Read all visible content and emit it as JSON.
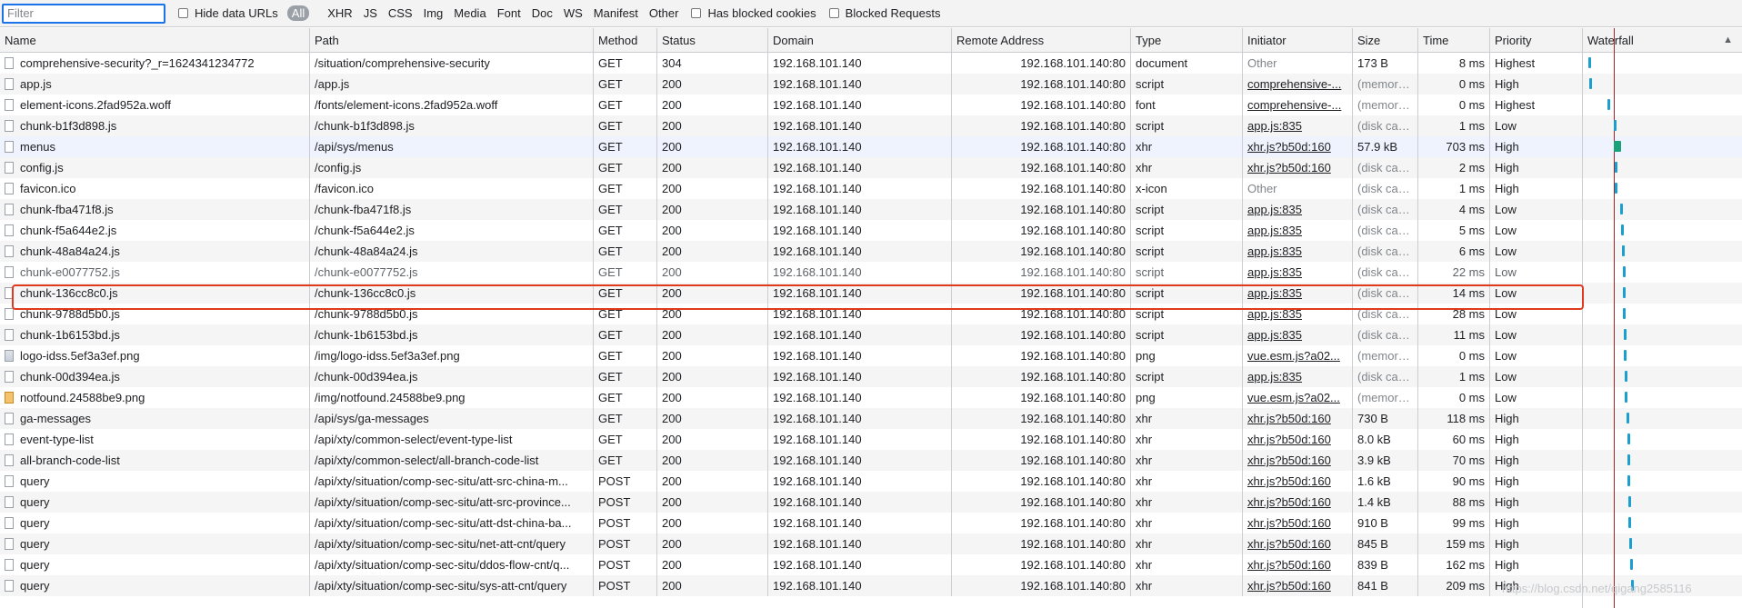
{
  "toolbar": {
    "filter_placeholder": "Filter",
    "hide_data_urls": "Hide data URLs",
    "types": [
      "All",
      "XHR",
      "JS",
      "CSS",
      "Img",
      "Media",
      "Font",
      "Doc",
      "WS",
      "Manifest",
      "Other"
    ],
    "has_blocked_cookies": "Has blocked cookies",
    "blocked_requests": "Blocked Requests"
  },
  "columns": [
    "Name",
    "Path",
    "Method",
    "Status",
    "Domain",
    "Remote Address",
    "Type",
    "Initiator",
    "Size",
    "Time",
    "Priority",
    "Waterfall"
  ],
  "sort_arrow": "▲",
  "rows": [
    {
      "name": "comprehensive-security?_r=1624341234772",
      "path": "/situation/comprehensive-security",
      "method": "GET",
      "status": "304",
      "domain": "192.168.101.140",
      "remote": "192.168.101.140:80",
      "type": "document",
      "initiator": "Other",
      "size": "173 B",
      "time": "8 ms",
      "priority": "Highest"
    },
    {
      "name": "app.js",
      "path": "/app.js",
      "method": "GET",
      "status": "200",
      "domain": "192.168.101.140",
      "remote": "192.168.101.140:80",
      "type": "script",
      "initiator": "comprehensive-...",
      "size": "(memory...",
      "time": "0 ms",
      "priority": "High"
    },
    {
      "name": "element-icons.2fad952a.woff",
      "path": "/fonts/element-icons.2fad952a.woff",
      "method": "GET",
      "status": "200",
      "domain": "192.168.101.140",
      "remote": "192.168.101.140:80",
      "type": "font",
      "initiator": "comprehensive-...",
      "size": "(memory...",
      "time": "0 ms",
      "priority": "Highest"
    },
    {
      "name": "chunk-b1f3d898.js",
      "path": "/chunk-b1f3d898.js",
      "method": "GET",
      "status": "200",
      "domain": "192.168.101.140",
      "remote": "192.168.101.140:80",
      "type": "script",
      "initiator": "app.js:835",
      "size": "(disk cac...",
      "time": "1 ms",
      "priority": "Low"
    },
    {
      "name": "menus",
      "path": "/api/sys/menus",
      "method": "GET",
      "status": "200",
      "domain": "192.168.101.140",
      "remote": "192.168.101.140:80",
      "type": "xhr",
      "initiator": "xhr.js?b50d:160",
      "size": "57.9 kB",
      "time": "703 ms",
      "priority": "High"
    },
    {
      "name": "config.js",
      "path": "/config.js",
      "method": "GET",
      "status": "200",
      "domain": "192.168.101.140",
      "remote": "192.168.101.140:80",
      "type": "xhr",
      "initiator": "xhr.js?b50d:160",
      "size": "(disk cac...",
      "time": "2 ms",
      "priority": "High"
    },
    {
      "name": "favicon.ico",
      "path": "/favicon.ico",
      "method": "GET",
      "status": "200",
      "domain": "192.168.101.140",
      "remote": "192.168.101.140:80",
      "type": "x-icon",
      "initiator": "Other",
      "size": "(disk cac...",
      "time": "1 ms",
      "priority": "High"
    },
    {
      "name": "chunk-fba471f8.js",
      "path": "/chunk-fba471f8.js",
      "method": "GET",
      "status": "200",
      "domain": "192.168.101.140",
      "remote": "192.168.101.140:80",
      "type": "script",
      "initiator": "app.js:835",
      "size": "(disk cac...",
      "time": "4 ms",
      "priority": "Low"
    },
    {
      "name": "chunk-f5a644e2.js",
      "path": "/chunk-f5a644e2.js",
      "method": "GET",
      "status": "200",
      "domain": "192.168.101.140",
      "remote": "192.168.101.140:80",
      "type": "script",
      "initiator": "app.js:835",
      "size": "(disk cac...",
      "time": "5 ms",
      "priority": "Low"
    },
    {
      "name": "chunk-48a84a24.js",
      "path": "/chunk-48a84a24.js",
      "method": "GET",
      "status": "200",
      "domain": "192.168.101.140",
      "remote": "192.168.101.140:80",
      "type": "script",
      "initiator": "app.js:835",
      "size": "(disk cac...",
      "time": "6 ms",
      "priority": "Low"
    },
    {
      "name": "chunk-e0077752.js",
      "path": "/chunk-e0077752.js",
      "method": "GET",
      "status": "200",
      "domain": "192.168.101.140",
      "remote": "192.168.101.140:80",
      "type": "script",
      "initiator": "app.js:835",
      "size": "(disk cac...",
      "time": "22 ms",
      "priority": "Low"
    },
    {
      "name": "chunk-136cc8c0.js",
      "path": "/chunk-136cc8c0.js",
      "method": "GET",
      "status": "200",
      "domain": "192.168.101.140",
      "remote": "192.168.101.140:80",
      "type": "script",
      "initiator": "app.js:835",
      "size": "(disk cac...",
      "time": "14 ms",
      "priority": "Low"
    },
    {
      "name": "chunk-9788d5b0.js",
      "path": "/chunk-9788d5b0.js",
      "method": "GET",
      "status": "200",
      "domain": "192.168.101.140",
      "remote": "192.168.101.140:80",
      "type": "script",
      "initiator": "app.js:835",
      "size": "(disk cac...",
      "time": "28 ms",
      "priority": "Low"
    },
    {
      "name": "chunk-1b6153bd.js",
      "path": "/chunk-1b6153bd.js",
      "method": "GET",
      "status": "200",
      "domain": "192.168.101.140",
      "remote": "192.168.101.140:80",
      "type": "script",
      "initiator": "app.js:835",
      "size": "(disk cac...",
      "time": "11 ms",
      "priority": "Low"
    },
    {
      "name": "logo-idss.5ef3a3ef.png",
      "path": "/img/logo-idss.5ef3a3ef.png",
      "method": "GET",
      "status": "200",
      "domain": "192.168.101.140",
      "remote": "192.168.101.140:80",
      "type": "png",
      "initiator": "vue.esm.js?a02...",
      "size": "(memory...",
      "time": "0 ms",
      "priority": "Low"
    },
    {
      "name": "chunk-00d394ea.js",
      "path": "/chunk-00d394ea.js",
      "method": "GET",
      "status": "200",
      "domain": "192.168.101.140",
      "remote": "192.168.101.140:80",
      "type": "script",
      "initiator": "app.js:835",
      "size": "(disk cac...",
      "time": "1 ms",
      "priority": "Low"
    },
    {
      "name": "notfound.24588be9.png",
      "path": "/img/notfound.24588be9.png",
      "method": "GET",
      "status": "200",
      "domain": "192.168.101.140",
      "remote": "192.168.101.140:80",
      "type": "png",
      "initiator": "vue.esm.js?a02...",
      "size": "(memory...",
      "time": "0 ms",
      "priority": "Low"
    },
    {
      "name": "ga-messages",
      "path": "/api/sys/ga-messages",
      "method": "GET",
      "status": "200",
      "domain": "192.168.101.140",
      "remote": "192.168.101.140:80",
      "type": "xhr",
      "initiator": "xhr.js?b50d:160",
      "size": "730 B",
      "time": "118 ms",
      "priority": "High"
    },
    {
      "name": "event-type-list",
      "path": "/api/xty/common-select/event-type-list",
      "method": "GET",
      "status": "200",
      "domain": "192.168.101.140",
      "remote": "192.168.101.140:80",
      "type": "xhr",
      "initiator": "xhr.js?b50d:160",
      "size": "8.0 kB",
      "time": "60 ms",
      "priority": "High"
    },
    {
      "name": "all-branch-code-list",
      "path": "/api/xty/common-select/all-branch-code-list",
      "method": "GET",
      "status": "200",
      "domain": "192.168.101.140",
      "remote": "192.168.101.140:80",
      "type": "xhr",
      "initiator": "xhr.js?b50d:160",
      "size": "3.9 kB",
      "time": "70 ms",
      "priority": "High"
    },
    {
      "name": "query",
      "path": "/api/xty/situation/comp-sec-situ/att-src-china-m...",
      "method": "POST",
      "status": "200",
      "domain": "192.168.101.140",
      "remote": "192.168.101.140:80",
      "type": "xhr",
      "initiator": "xhr.js?b50d:160",
      "size": "1.6 kB",
      "time": "90 ms",
      "priority": "High"
    },
    {
      "name": "query",
      "path": "/api/xty/situation/comp-sec-situ/att-src-province...",
      "method": "POST",
      "status": "200",
      "domain": "192.168.101.140",
      "remote": "192.168.101.140:80",
      "type": "xhr",
      "initiator": "xhr.js?b50d:160",
      "size": "1.4 kB",
      "time": "88 ms",
      "priority": "High"
    },
    {
      "name": "query",
      "path": "/api/xty/situation/comp-sec-situ/att-dst-china-ba...",
      "method": "POST",
      "status": "200",
      "domain": "192.168.101.140",
      "remote": "192.168.101.140:80",
      "type": "xhr",
      "initiator": "xhr.js?b50d:160",
      "size": "910 B",
      "time": "99 ms",
      "priority": "High"
    },
    {
      "name": "query",
      "path": "/api/xty/situation/comp-sec-situ/net-att-cnt/query",
      "method": "POST",
      "status": "200",
      "domain": "192.168.101.140",
      "remote": "192.168.101.140:80",
      "type": "xhr",
      "initiator": "xhr.js?b50d:160",
      "size": "845 B",
      "time": "159 ms",
      "priority": "High"
    },
    {
      "name": "query",
      "path": "/api/xty/situation/comp-sec-situ/ddos-flow-cnt/q...",
      "method": "POST",
      "status": "200",
      "domain": "192.168.101.140",
      "remote": "192.168.101.140:80",
      "type": "xhr",
      "initiator": "xhr.js?b50d:160",
      "size": "839 B",
      "time": "162 ms",
      "priority": "High"
    },
    {
      "name": "query",
      "path": "/api/xty/situation/comp-sec-situ/sys-att-cnt/query",
      "method": "POST",
      "status": "200",
      "domain": "192.168.101.140",
      "remote": "192.168.101.140:80",
      "type": "xhr",
      "initiator": "xhr.js?b50d:160",
      "size": "841 B",
      "time": "209 ms",
      "priority": "High"
    }
  ],
  "watermark": "https://blog.csdn.net/qigang2585116",
  "colors": {
    "waterfall_bar": "#1a9fd0",
    "waterfall_long_bar": "#1aa37a",
    "load_line": "#a3262b",
    "selection_box": "#e03a1e"
  }
}
